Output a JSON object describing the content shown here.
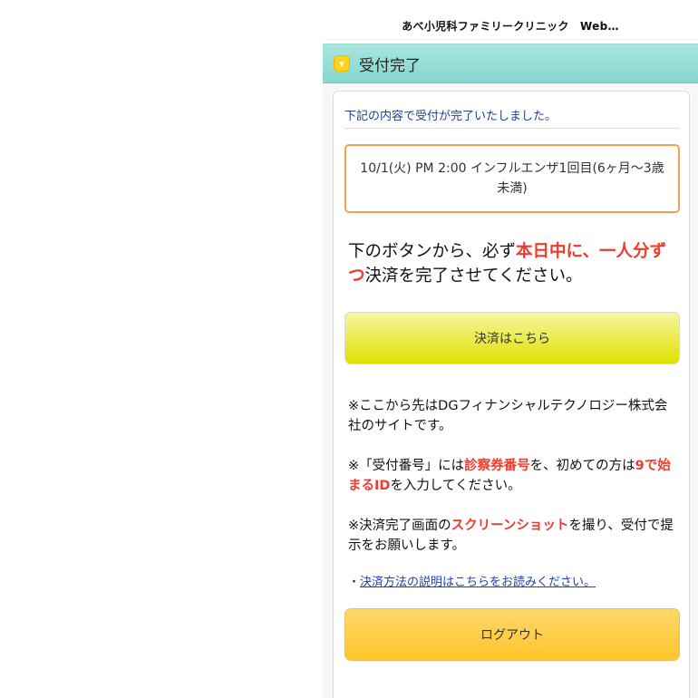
{
  "browser": {
    "title": "あべ小児科ファミリークリニック　Web…"
  },
  "header": {
    "title": "受付完了",
    "icon": "calendar-icon"
  },
  "content": {
    "lead": "下記の内容で受付が完了いたしました。",
    "booking": "10/1(火) PM 2:00 インフルエンザ1回目(6ヶ月〜3歳未満)",
    "instruction": {
      "part1": "下のボタンから、必ず",
      "highlight": "本日中に、一人分ずつ",
      "part2": "決済を完了させてください。"
    },
    "pay_button": "決済はこちら",
    "note1": "※ここから先はDGフィナンシャルテクノロジー株式会社のサイトです。",
    "note2": {
      "part1": "※「受付番号」には",
      "highlight1": "診察券番号",
      "part2": "を、初めての方は",
      "highlight2": "9で始まるID",
      "part3": "を入力してください。"
    },
    "note3": {
      "part1": "※決済完了画面の",
      "highlight": "スクリーンショット",
      "part2": "を撮り、受付で提示をお願いします。"
    },
    "link_prefix": "・",
    "link_text": "決済方法の説明はこちらをお読みください。",
    "logout_button": "ログアウト"
  },
  "colors": {
    "header": "#86d6cd",
    "accent_red": "#f03a2c",
    "booking_border": "#f5a050",
    "pay_button": "#e0e000",
    "logout_button": "#ffc52a",
    "link": "#1f3fb0"
  }
}
